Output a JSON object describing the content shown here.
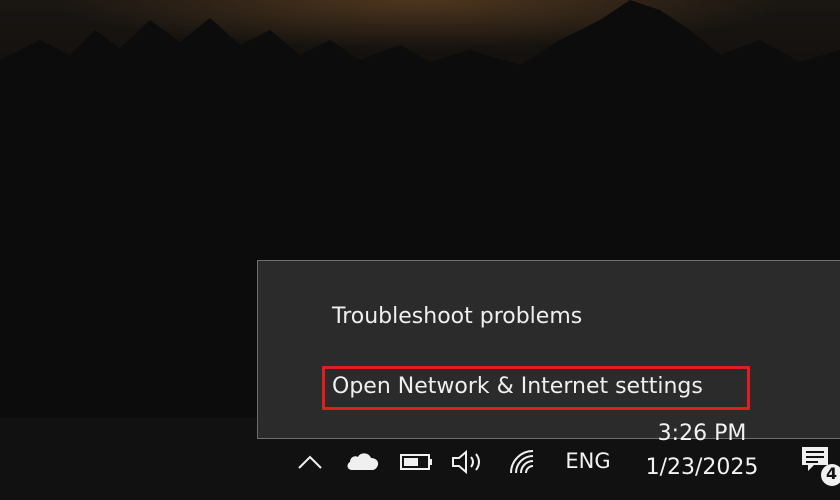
{
  "context_menu": {
    "items": [
      {
        "label": "Troubleshoot problems"
      },
      {
        "label": "Open Network & Internet settings",
        "highlighted": true
      }
    ],
    "highlight_color": "#e01e1e"
  },
  "taskbar": {
    "tray_icons": [
      "chevron-up-icon",
      "onedrive-cloud-icon",
      "battery-icon",
      "volume-icon",
      "wifi-icon"
    ],
    "language": "ENG",
    "clock": {
      "time": "3:26 PM",
      "date": "1/23/2025"
    },
    "notification_badge": "4"
  }
}
